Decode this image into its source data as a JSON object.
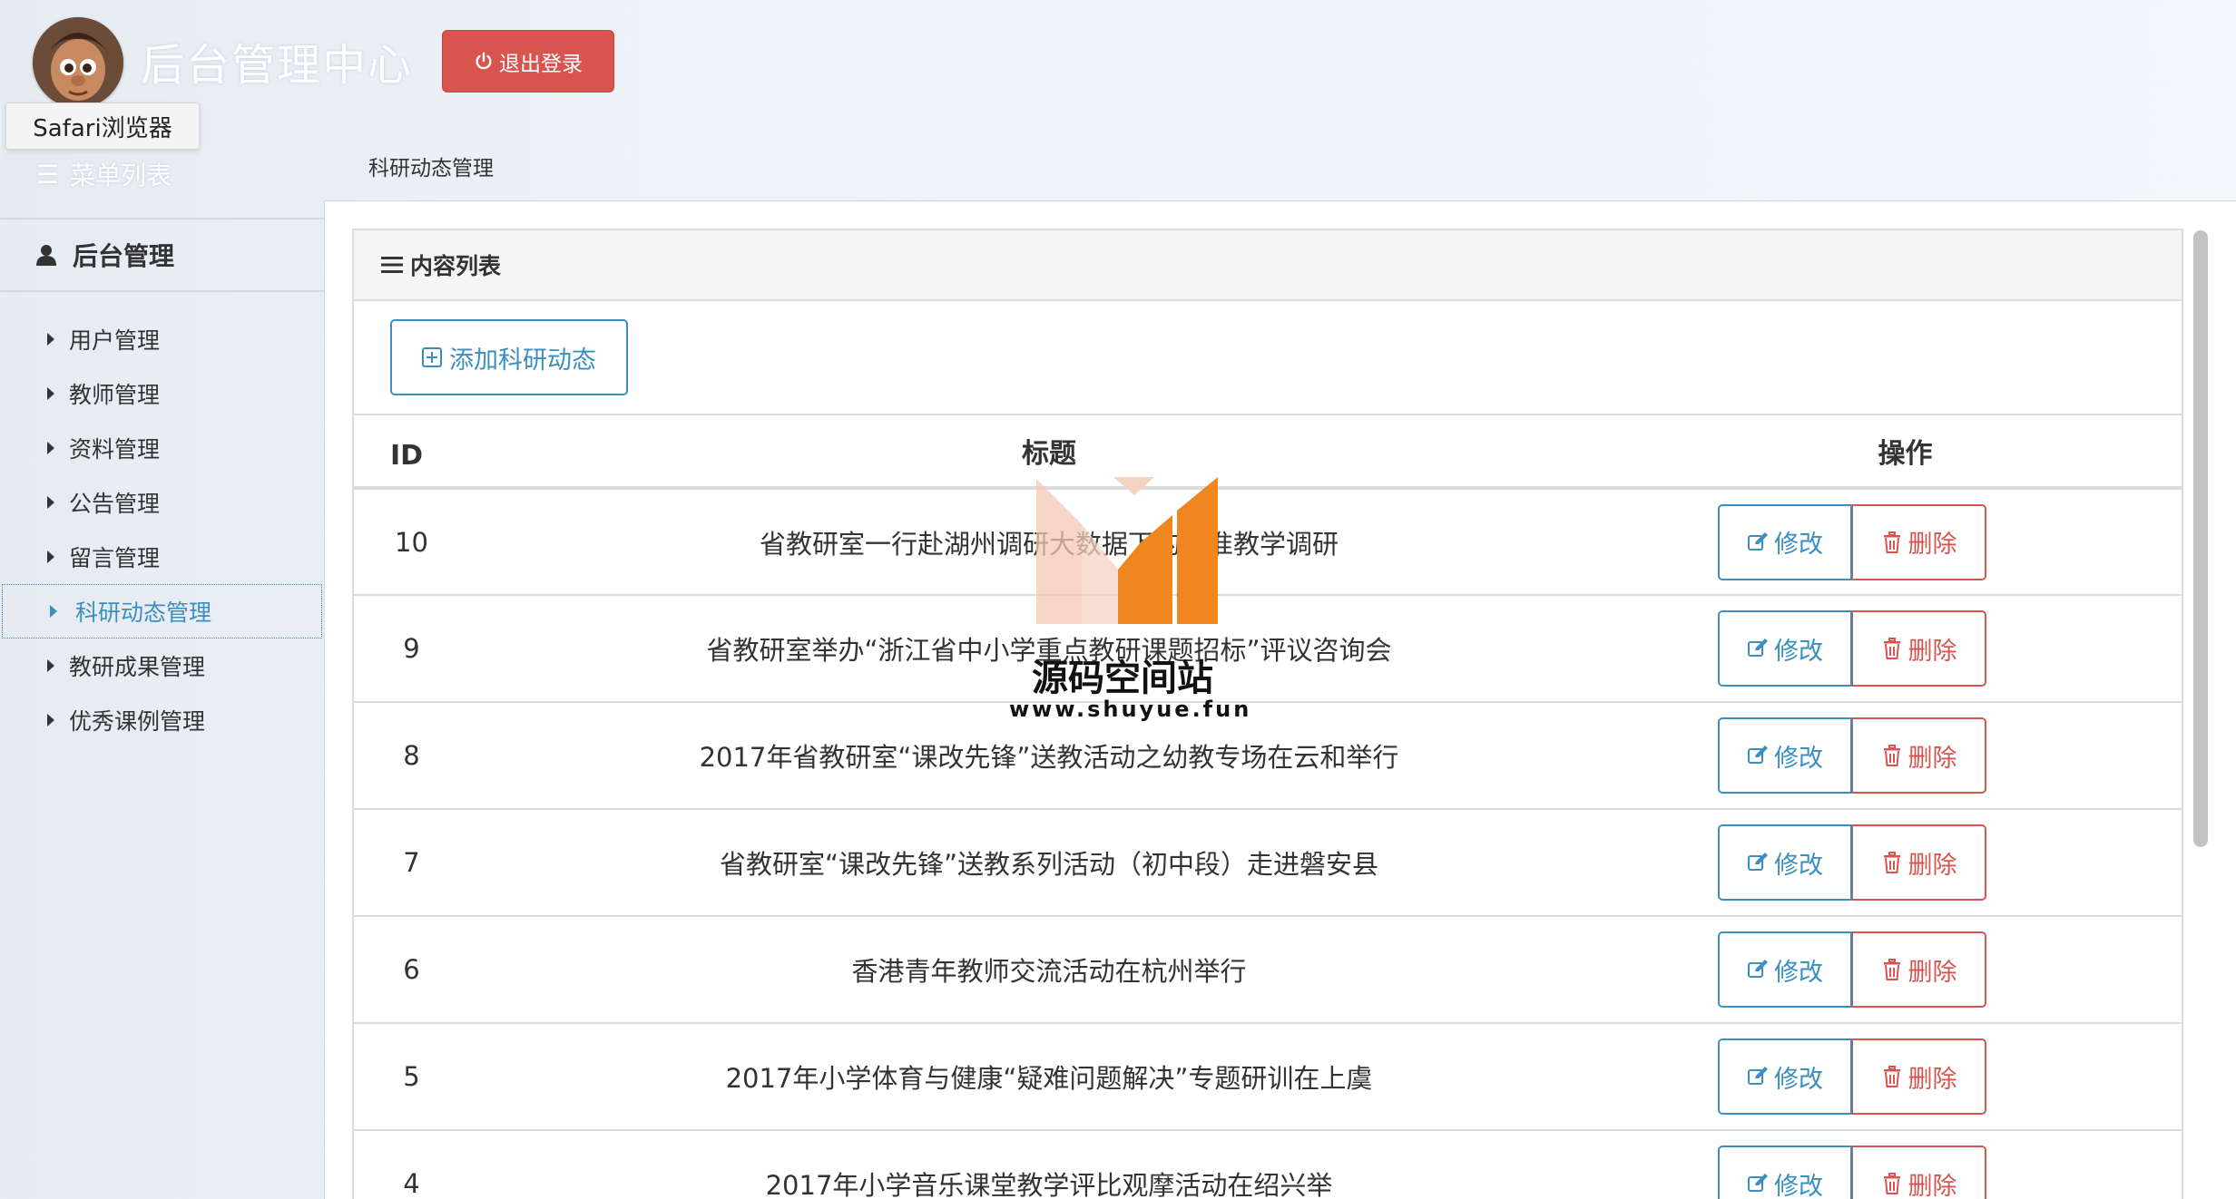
{
  "header": {
    "app_title": "后台管理中心",
    "logout_label": "退出登录",
    "tooltip": "Safari浏览器",
    "menu_toggle_label": "菜单列表",
    "breadcrumb": "科研动态管理"
  },
  "sidebar": {
    "title": "后台管理",
    "items": [
      {
        "label": "用户管理"
      },
      {
        "label": "教师管理"
      },
      {
        "label": "资料管理"
      },
      {
        "label": "公告管理"
      },
      {
        "label": "留言管理"
      },
      {
        "label": "科研动态管理",
        "active": true
      },
      {
        "label": "教研成果管理"
      },
      {
        "label": "优秀课例管理"
      }
    ]
  },
  "panel": {
    "title": "内容列表",
    "add_button": "添加科研动态"
  },
  "table": {
    "headers": {
      "id": "ID",
      "title": "标题",
      "actions": "操作"
    },
    "edit_label": "修改",
    "delete_label": "删除",
    "rows": [
      {
        "id": "10",
        "title": "省教研室一行赴湖州调研大数据下的精准教学调研"
      },
      {
        "id": "9",
        "title": "省教研室举办“浙江省中小学重点教研课题招标”评议咨询会"
      },
      {
        "id": "8",
        "title": "2017年省教研室“课改先锋”送教活动之幼教专场在云和举行"
      },
      {
        "id": "7",
        "title": "省教研室“课改先锋”送教系列活动（初中段）走进磐安县"
      },
      {
        "id": "6",
        "title": "香港青年教师交流活动在杭州举行"
      },
      {
        "id": "5",
        "title": "2017年小学体育与健康“疑难问题解决”专题研训在上虞"
      },
      {
        "id": "4",
        "title": "2017年小学音乐课堂教学评比观摩活动在绍兴举"
      }
    ]
  },
  "watermark": {
    "name": "源码空间站",
    "url": "www.shuyue.fun"
  },
  "colors": {
    "primary": "#3a8fc0",
    "danger": "#d9534f",
    "logo_orange": "#f0861f"
  }
}
